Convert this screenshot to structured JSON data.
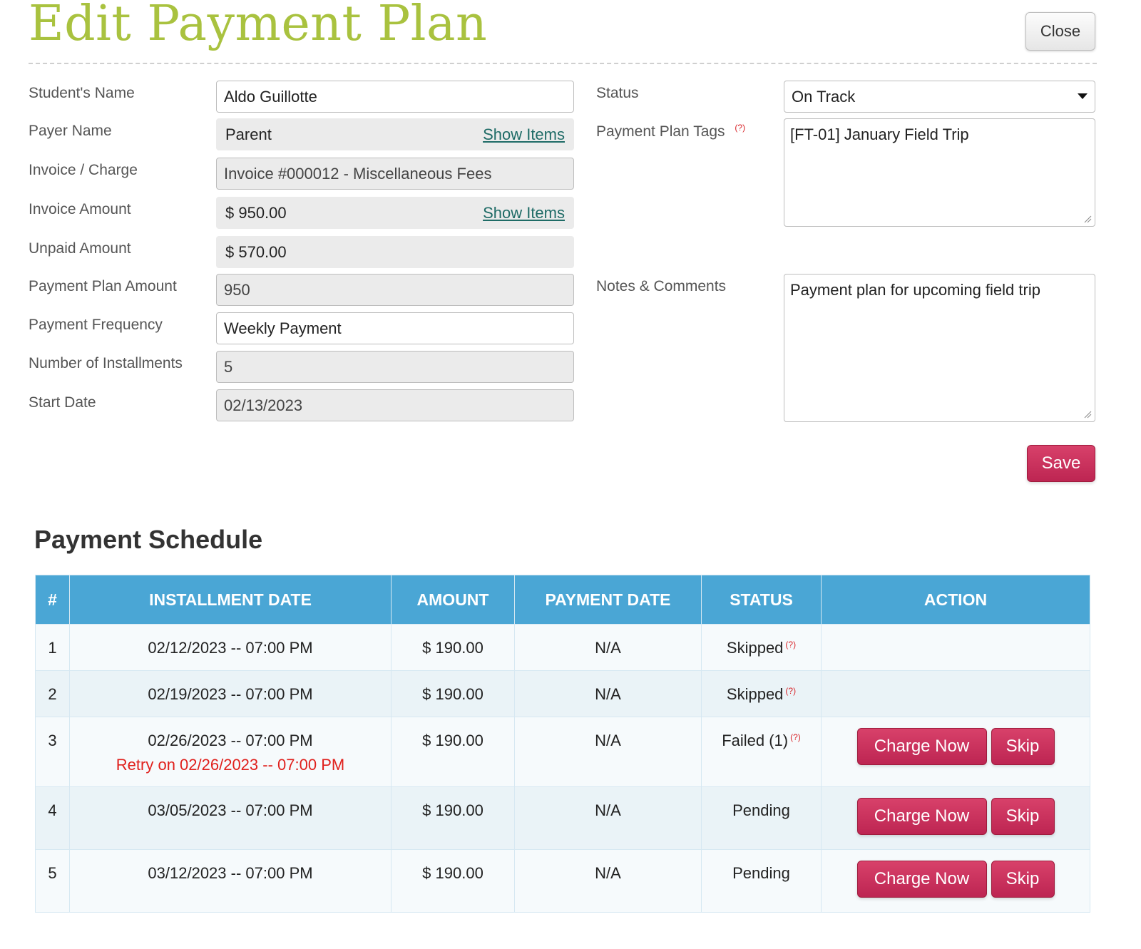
{
  "header": {
    "title": "Edit Payment Plan",
    "close_label": "Close"
  },
  "form_left": {
    "student_name": {
      "label": "Student's Name",
      "value": "Aldo Guillotte"
    },
    "payer_name": {
      "label": "Payer Name",
      "value": "Parent",
      "link": "Show Items"
    },
    "invoice_charge": {
      "label": "Invoice / Charge",
      "value": "Invoice #000012 - Miscellaneous Fees"
    },
    "invoice_amount": {
      "label": "Invoice Amount",
      "value": "$ 950.00",
      "link": "Show Items"
    },
    "unpaid_amount": {
      "label": "Unpaid Amount",
      "value": "$ 570.00"
    },
    "plan_amount": {
      "label": "Payment Plan Amount",
      "value": "950"
    },
    "frequency": {
      "label": "Payment Frequency",
      "value": "Weekly Payment"
    },
    "installments": {
      "label": "Number of Installments",
      "value": "5"
    },
    "start_date": {
      "label": "Start Date",
      "value": "02/13/2023"
    }
  },
  "form_right": {
    "status": {
      "label": "Status",
      "value": "On Track"
    },
    "tags": {
      "label": "Payment Plan Tags",
      "help": "(?)",
      "value": "[FT-01] January Field Trip"
    },
    "notes": {
      "label": "Notes & Comments",
      "value": "Payment plan for upcoming field trip"
    }
  },
  "save_label": "Save",
  "schedule": {
    "heading": "Payment Schedule",
    "columns": [
      "#",
      "INSTALLMENT DATE",
      "AMOUNT",
      "PAYMENT DATE",
      "STATUS",
      "ACTION"
    ],
    "help": "(?)",
    "charge_label": "Charge Now",
    "skip_label": "Skip",
    "rows": [
      {
        "num": "1",
        "date": "02/12/2023 -- 07:00 PM",
        "amount": "$ 190.00",
        "payment_date": "N/A",
        "status": "Skipped"
      },
      {
        "num": "2",
        "date": "02/19/2023 -- 07:00 PM",
        "amount": "$ 190.00",
        "payment_date": "N/A",
        "status": "Skipped"
      },
      {
        "num": "3",
        "date": "02/26/2023 -- 07:00 PM",
        "retry": "Retry on 02/26/2023 -- 07:00 PM",
        "amount": "$ 190.00",
        "payment_date": "N/A",
        "status": "Failed (1)"
      },
      {
        "num": "4",
        "date": "03/05/2023 -- 07:00 PM",
        "amount": "$ 190.00",
        "payment_date": "N/A",
        "status": "Pending"
      },
      {
        "num": "5",
        "date": "03/12/2023 -- 07:00 PM",
        "amount": "$ 190.00",
        "payment_date": "N/A",
        "status": "Pending"
      }
    ]
  }
}
